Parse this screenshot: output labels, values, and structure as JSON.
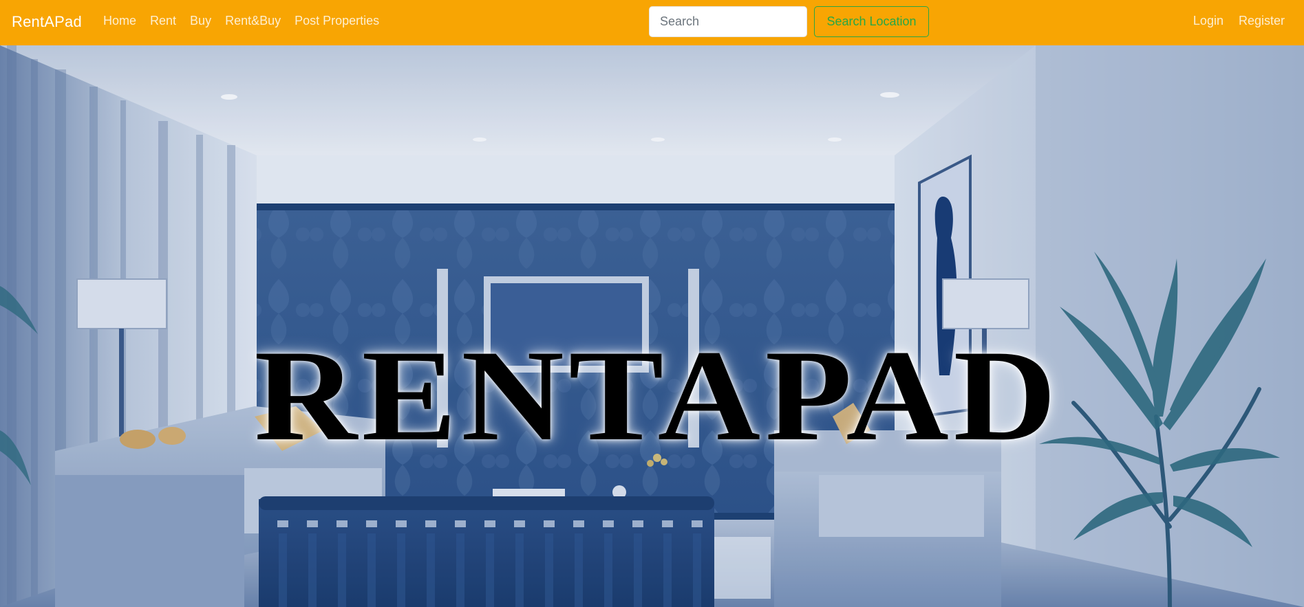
{
  "navbar": {
    "brand": "RentAPad",
    "links": [
      {
        "label": "Home"
      },
      {
        "label": "Rent"
      },
      {
        "label": "Buy"
      },
      {
        "label": "Rent&Buy"
      },
      {
        "label": "Post Properties"
      }
    ],
    "search": {
      "placeholder": "Search",
      "value": "",
      "button_label": "Search Location"
    },
    "auth": {
      "login": "Login",
      "register": "Register"
    }
  },
  "hero": {
    "title": "RENTAPAD",
    "background": "blue-tinted living room interior"
  },
  "colors": {
    "navbar": "#f8a503",
    "search_button": "#28a745",
    "hero_tint": "#2a4f86"
  }
}
